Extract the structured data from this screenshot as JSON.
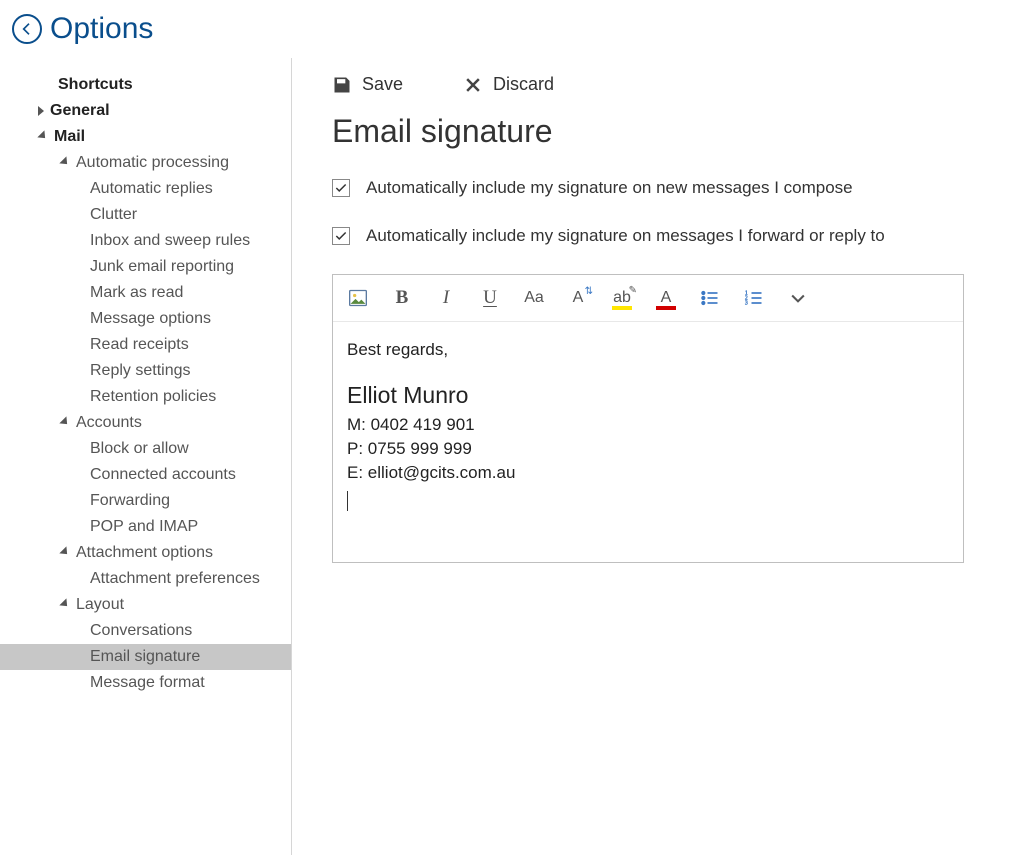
{
  "header": {
    "title": "Options"
  },
  "actions": {
    "save": "Save",
    "discard": "Discard"
  },
  "page": {
    "title": "Email signature",
    "check1": "Automatically include my signature on new messages I compose",
    "check2": "Automatically include my signature on messages I forward or reply to"
  },
  "signature": {
    "greeting": "Best regards,",
    "name": "Elliot Munro",
    "mobile": "M: 0402 419 901",
    "phone": "P: 0755 999 999",
    "email": "E: elliot@gcits.com.au"
  },
  "sidebar": {
    "shortcuts": "Shortcuts",
    "general": "General",
    "mail": "Mail",
    "autoproc": "Automatic processing",
    "autoreplies": "Automatic replies",
    "clutter": "Clutter",
    "inboxrules": "Inbox and sweep rules",
    "junk": "Junk email reporting",
    "markread": "Mark as read",
    "msgopts": "Message options",
    "readrec": "Read receipts",
    "replyset": "Reply settings",
    "retention": "Retention policies",
    "accounts": "Accounts",
    "blockallow": "Block or allow",
    "connected": "Connected accounts",
    "forwarding": "Forwarding",
    "popimap": "POP and IMAP",
    "attachopts": "Attachment options",
    "attachprefs": "Attachment preferences",
    "layout": "Layout",
    "conversations": "Conversations",
    "emailsig": "Email signature",
    "msgformat": "Message format"
  },
  "toolbar": {
    "bold": "B",
    "italic": "I",
    "underline": "U",
    "fontsize_label": "Aa",
    "fontstyle_label": "A",
    "highlight_label": "ab",
    "fontcolor_label": "A"
  }
}
